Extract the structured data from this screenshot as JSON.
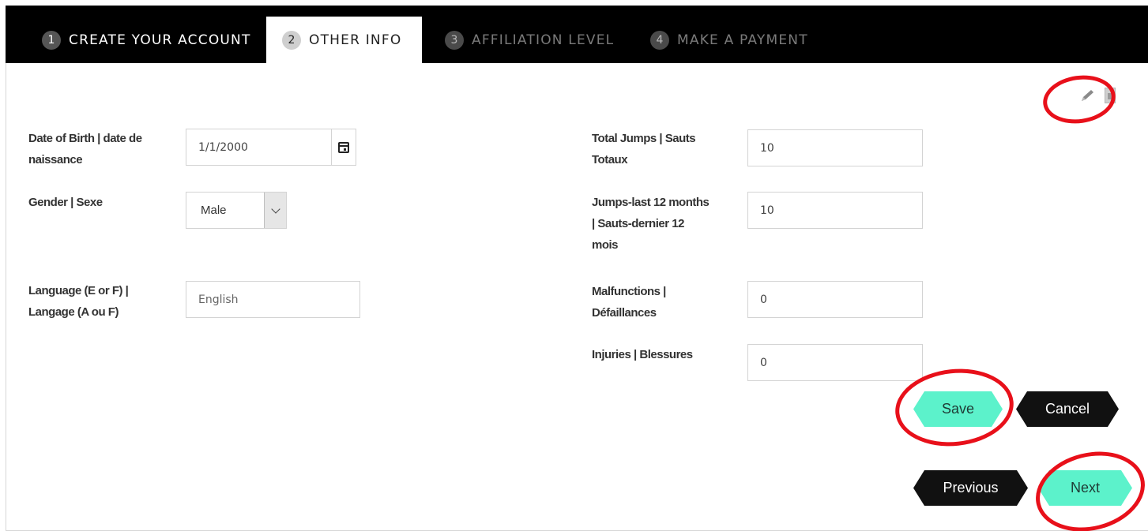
{
  "tabs": [
    {
      "num": "1",
      "label": "CREATE YOUR ACCOUNT",
      "state": "completed"
    },
    {
      "num": "2",
      "label": "OTHER INFO",
      "state": "active"
    },
    {
      "num": "3",
      "label": "AFFILIATION LEVEL",
      "state": "disabled"
    },
    {
      "num": "4",
      "label": "MAKE A PAYMENT",
      "state": "disabled"
    }
  ],
  "toolbar": {
    "icons": [
      "pencil-icon",
      "document-icon"
    ]
  },
  "form": {
    "dob": {
      "label_line1": "Date of Birth | date de",
      "label_line2": "naissance",
      "value": "1/1/2000"
    },
    "gender": {
      "label": "Gender | Sexe",
      "value": "Male"
    },
    "language": {
      "label_line1": "Language (E or F) |",
      "label_line2": "Langage (A ou F)",
      "value": "English"
    },
    "total_jumps": {
      "label_line1": "Total Jumps | Sauts",
      "label_line2": "Totaux",
      "value": "10"
    },
    "jumps_12": {
      "label_line1": "Jumps-last 12 months",
      "label_line2": "| Sauts-dernier 12",
      "label_line3": "mois",
      "value": "10"
    },
    "malfunctions": {
      "label_line1": "Malfunctions |",
      "label_line2": "Défaillances",
      "value": "0"
    },
    "injuries": {
      "label": "Injuries | Blessures",
      "value": "0"
    }
  },
  "buttons": {
    "save": "Save",
    "cancel": "Cancel",
    "previous": "Previous",
    "next": "Next"
  },
  "colors": {
    "accent": "#5cf2cb",
    "dark": "#111111",
    "annotation": "#e8101a"
  }
}
